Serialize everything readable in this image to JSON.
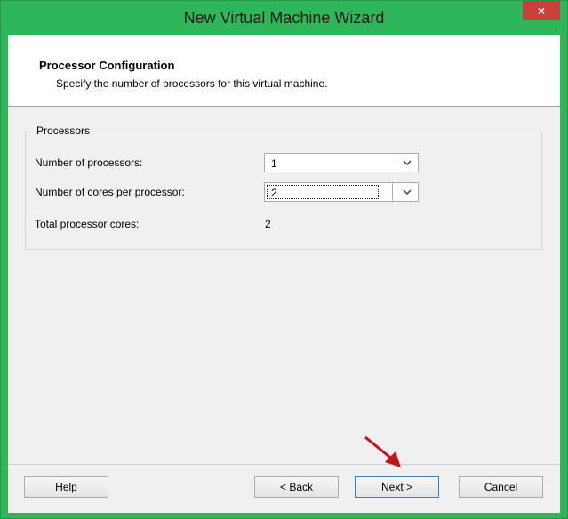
{
  "window": {
    "title": "New Virtual Machine Wizard",
    "close_glyph": "×",
    "title_bar_color": "#2fb65a",
    "close_button_color": "#c7423a"
  },
  "header": {
    "title": "Processor Configuration",
    "subtitle": "Specify the number of processors for this virtual machine."
  },
  "processors": {
    "group_label": "Processors",
    "num_processors_label": "Number of processors:",
    "num_processors_value": "1",
    "cores_per_processor_label": "Number of cores per processor:",
    "cores_per_processor_value": "2",
    "total_cores_label": "Total processor cores:",
    "total_cores_value": "2"
  },
  "buttons": {
    "help": "Help",
    "back": "< Back",
    "next": "Next >",
    "cancel": "Cancel"
  },
  "icons": {
    "dropdown": "chevron-down-icon",
    "annotation": "red-arrow-icon",
    "chevron_glyph": "⌄"
  },
  "annotation_color": "#c0161b"
}
